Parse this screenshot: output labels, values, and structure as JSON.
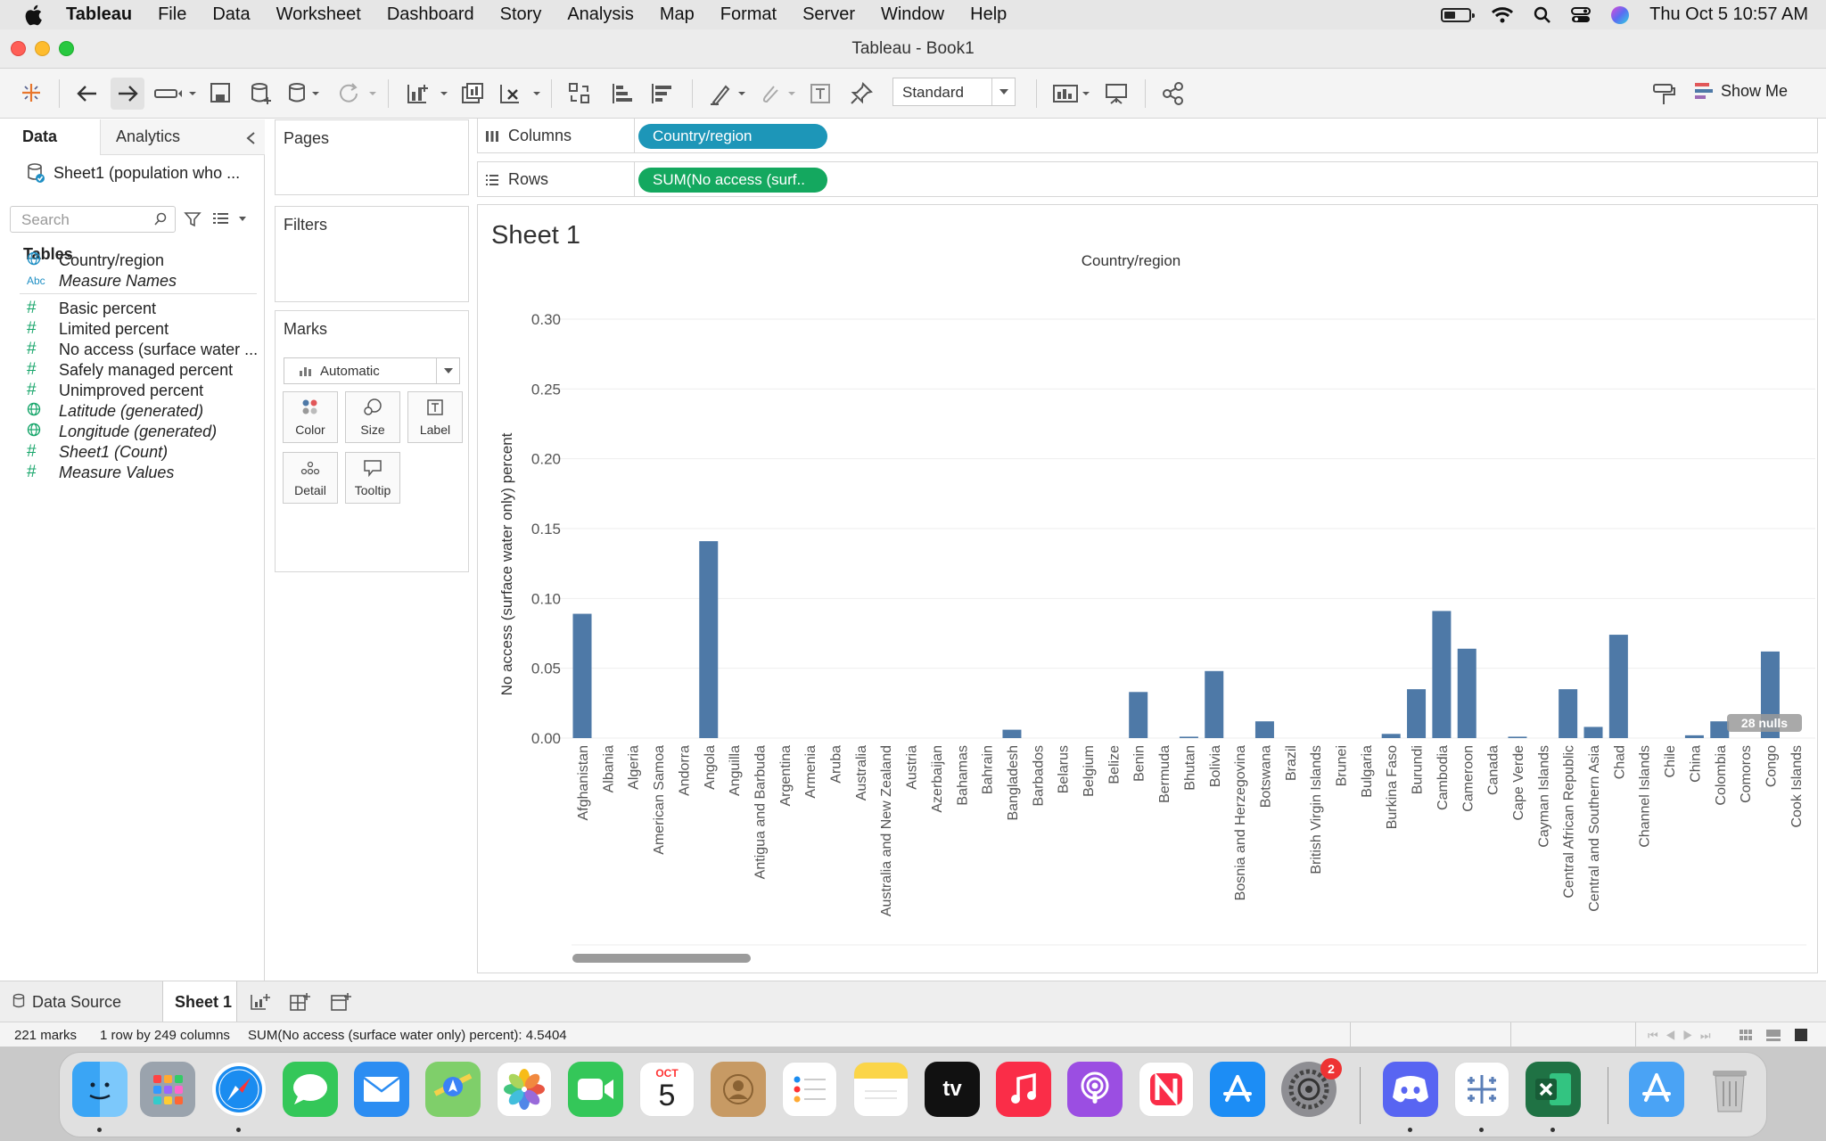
{
  "menubar": {
    "app": "Tableau",
    "items": [
      "File",
      "Data",
      "Worksheet",
      "Dashboard",
      "Story",
      "Analysis",
      "Map",
      "Format",
      "Server",
      "Window",
      "Help"
    ],
    "clock": "Thu Oct 5  10:57 AM"
  },
  "window": {
    "title": "Tableau - Book1"
  },
  "toolbar": {
    "view_mode": "Standard",
    "show_me": "Show Me"
  },
  "data_pane": {
    "tab_data": "Data",
    "tab_analytics": "Analytics",
    "datasource": "Sheet1 (population who ...",
    "search_placeholder": "Search",
    "tables_header": "Tables",
    "fields": [
      {
        "label": "Country/region",
        "icon": "globe-icon",
        "type": "dim",
        "italic": false
      },
      {
        "label": "Measure Names",
        "icon": "abc-icon",
        "type": "dim",
        "italic": true
      },
      {
        "label": "Basic percent",
        "icon": "hash-icon",
        "type": "measure",
        "italic": false
      },
      {
        "label": "Limited percent",
        "icon": "hash-icon",
        "type": "measure",
        "italic": false
      },
      {
        "label": "No access (surface water ...",
        "icon": "hash-icon",
        "type": "measure",
        "italic": false
      },
      {
        "label": "Safely managed percent",
        "icon": "hash-icon",
        "type": "measure",
        "italic": false
      },
      {
        "label": "Unimproved percent",
        "icon": "hash-icon",
        "type": "measure",
        "italic": false
      },
      {
        "label": "Latitude (generated)",
        "icon": "globe-icon",
        "type": "measure",
        "italic": true
      },
      {
        "label": "Longitude (generated)",
        "icon": "globe-icon",
        "type": "measure",
        "italic": true
      },
      {
        "label": "Sheet1 (Count)",
        "icon": "hash-icon",
        "type": "measure",
        "italic": true
      },
      {
        "label": "Measure Values",
        "icon": "hash-icon",
        "type": "measure",
        "italic": true
      }
    ]
  },
  "shelves": {
    "pages": "Pages",
    "filters": "Filters",
    "marks": "Marks",
    "marks_type": "Automatic",
    "mark_buttons": [
      "Color",
      "Size",
      "Label",
      "Detail",
      "Tooltip"
    ],
    "columns_label": "Columns",
    "columns_pill": "Country/region",
    "rows_label": "Rows",
    "rows_pill": "SUM(No access (surf.."
  },
  "sheet": {
    "title": "Sheet 1",
    "nulls_badge": "28 nulls"
  },
  "chart_data": {
    "type": "bar",
    "title": "",
    "column_header": "Country/region",
    "xlabel": "",
    "ylabel": "No access (surface water only) percent",
    "ylim": [
      0,
      0.3
    ],
    "yticks": [
      "0.00",
      "0.05",
      "0.10",
      "0.15",
      "0.20",
      "0.25",
      "0.30"
    ],
    "grid": true,
    "bar_color": "#4e79a7",
    "categories": [
      "Afghanistan",
      "Albania",
      "Algeria",
      "American Samoa",
      "Andorra",
      "Angola",
      "Anguilla",
      "Antigua and Barbuda",
      "Argentina",
      "Armenia",
      "Aruba",
      "Australia",
      "Australia and New Zealand",
      "Austria",
      "Azerbaijan",
      "Bahamas",
      "Bahrain",
      "Bangladesh",
      "Barbados",
      "Belarus",
      "Belgium",
      "Belize",
      "Benin",
      "Bermuda",
      "Bhutan",
      "Bolivia",
      "Bosnia and Herzegovina",
      "Botswana",
      "Brazil",
      "British Virgin Islands",
      "Brunei",
      "Bulgaria",
      "Burkina Faso",
      "Burundi",
      "Cambodia",
      "Cameroon",
      "Canada",
      "Cape Verde",
      "Cayman Islands",
      "Central African Republic",
      "Central and Southern Asia",
      "Chad",
      "Channel Islands",
      "Chile",
      "China",
      "Colombia",
      "Comoros",
      "Congo",
      "Cook Islands"
    ],
    "values": [
      0.089,
      0,
      0,
      0,
      0,
      0.141,
      0,
      0,
      0,
      0,
      0,
      0,
      0,
      0,
      0,
      0,
      0,
      0.006,
      0,
      0,
      0,
      0,
      0.033,
      0,
      0.001,
      0.048,
      0,
      0.012,
      0,
      0,
      0,
      0,
      0.003,
      0.035,
      0.091,
      0.064,
      0,
      0.001,
      0,
      0.035,
      0.008,
      0.074,
      0,
      0,
      0.002,
      0.012,
      0,
      0.062,
      0
    ]
  },
  "sheet_tabs": {
    "data_source": "Data Source",
    "sheet1": "Sheet 1"
  },
  "status": {
    "marks": "221 marks",
    "shape": "1 row by 249 columns",
    "sum": "SUM(No access (surface water only) percent): 4.5404"
  },
  "dock": {
    "calendar_month": "OCT",
    "calendar_day": "5",
    "badge_count": "2",
    "apps": [
      "finder",
      "launchpad",
      "safari",
      "messages",
      "mail",
      "maps",
      "photos",
      "facetime",
      "calendar",
      "contacts",
      "reminders",
      "notes",
      "tv",
      "music",
      "podcasts",
      "news",
      "app-store",
      "system-settings",
      "discord",
      "tableau",
      "excel",
      "downloads",
      "trash"
    ]
  },
  "colors": {
    "columns_pill": "#1d96b8",
    "rows_pill": "#14a85f",
    "measure_icon": "#18a66b",
    "dimension_icon": "#1f8fc4"
  }
}
